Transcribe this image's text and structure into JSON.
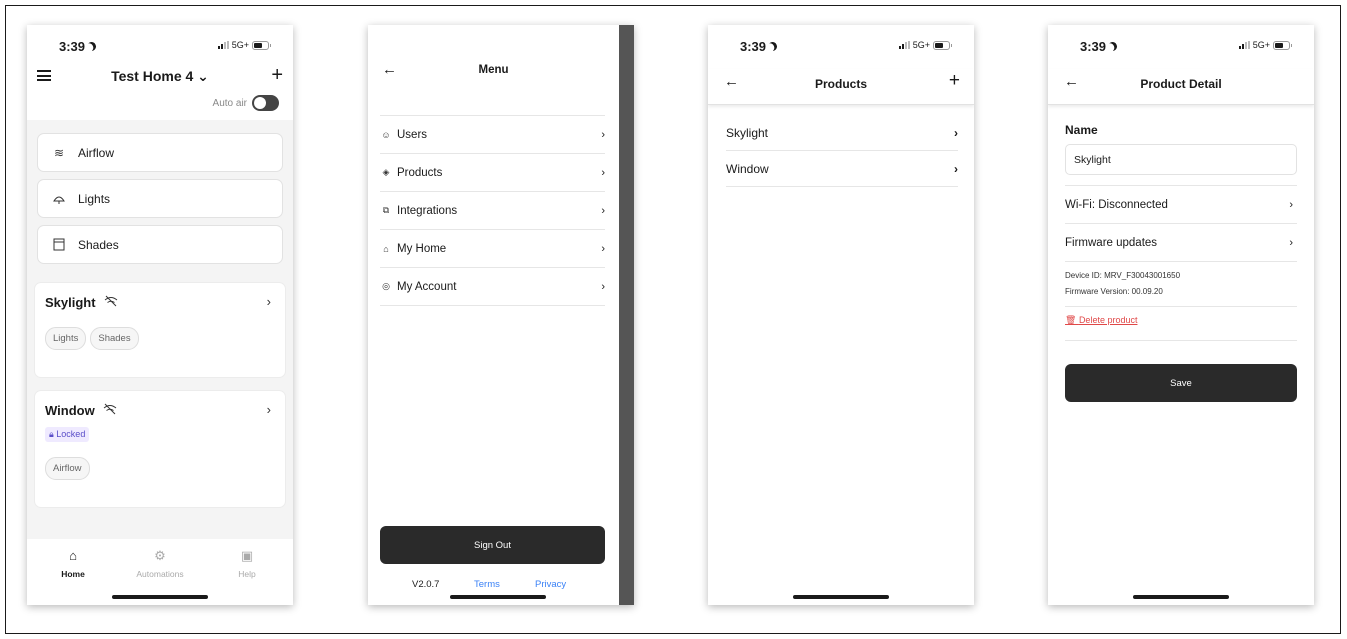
{
  "status": {
    "time": "3:39",
    "network": "5G+"
  },
  "home": {
    "title": "Test Home 4 ⌄",
    "auto_air_label": "Auto air",
    "controls": [
      {
        "label": "Airflow",
        "icon": "airflow-icon"
      },
      {
        "label": "Lights",
        "icon": "light-icon"
      },
      {
        "label": "Shades",
        "icon": "shade-icon"
      }
    ],
    "cards": [
      {
        "title": "Skylight",
        "chips": [
          "Lights",
          "Shades"
        ]
      },
      {
        "title": "Window",
        "badge": "Locked",
        "chips": [
          "Airflow"
        ]
      }
    ],
    "nav": {
      "home": "Home",
      "automations": "Automations",
      "help": "Help"
    }
  },
  "menu": {
    "title": "Menu",
    "items": [
      "Users",
      "Products",
      "Integrations",
      "My Home",
      "My Account"
    ],
    "sign_out": "Sign Out",
    "version": "V2.0.7",
    "terms": "Terms",
    "privacy": "Privacy"
  },
  "products": {
    "title": "Products",
    "items": [
      "Skylight",
      "Window"
    ]
  },
  "detail": {
    "title": "Product Detail",
    "name_label": "Name",
    "name_value": "Skylight",
    "wifi": "Wi-Fi: Disconnected",
    "firmware": "Firmware updates",
    "device_id": "Device ID: MRV_F30043001650",
    "firmware_version": "Firmware Version: 00.09.20",
    "delete": "Delete product",
    "save": "Save"
  },
  "colors": {
    "accent_dark": "#2a2a2a",
    "link_blue": "#3b82f6",
    "danger": "#e04848",
    "locked": "#5a4ec9"
  }
}
